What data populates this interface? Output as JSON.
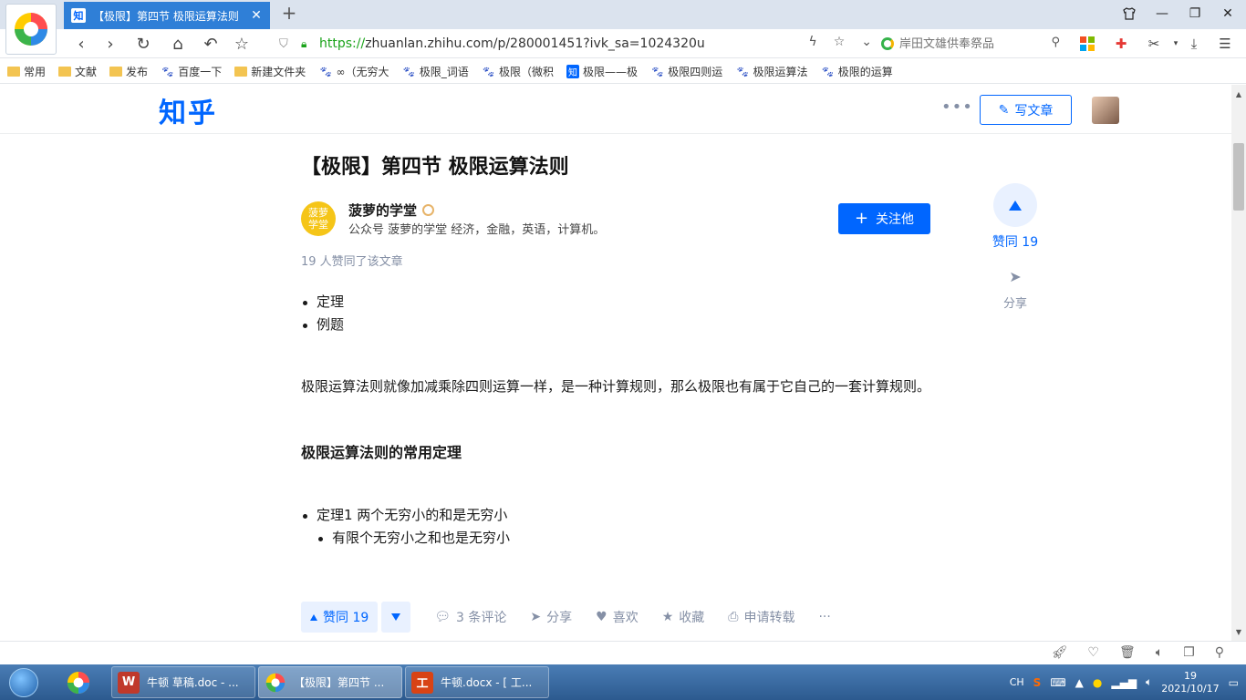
{
  "browser": {
    "tab_title": "【极限】第四节 极限运算法则",
    "tab_favicon": "知",
    "url_scheme": "https://",
    "url_rest": "zhuanlan.zhihu.com/p/280001451?ivk_sa=1024320u",
    "search_placeholder": "岸田文雄供奉祭品",
    "bookmarks": [
      {
        "icon": "folder",
        "label": "常用"
      },
      {
        "icon": "folder",
        "label": "文献"
      },
      {
        "icon": "folder",
        "label": "发布"
      },
      {
        "icon": "paw",
        "label": "百度一下"
      },
      {
        "icon": "folder",
        "label": "新建文件夹"
      },
      {
        "icon": "paw",
        "label": "∞（无穷大"
      },
      {
        "icon": "paw",
        "label": "极限_词语"
      },
      {
        "icon": "paw",
        "label": "极限（微积"
      },
      {
        "icon": "zhi",
        "label": "极限——极"
      },
      {
        "icon": "paw",
        "label": "极限四则运"
      },
      {
        "icon": "paw",
        "label": "极限运算法"
      },
      {
        "icon": "paw",
        "label": "极限的运算"
      }
    ]
  },
  "zhihu": {
    "logo": "知乎",
    "more": "•••",
    "write_label": "写文章"
  },
  "article": {
    "title": "【极限】第四节 极限运算法则",
    "author_avatar_text": "菠萝学堂",
    "author_name": "菠萝的学堂",
    "author_bio": "公众号 菠萝的学堂 经济，金融，英语，计算机。",
    "follow_label": "关注他",
    "upvoters": "19 人赞同了该文章",
    "toc": [
      "定理",
      "例题"
    ],
    "paragraph1": "极限运算法则就像加减乘除四则运算一样，是一种计算规则，那么极限也有属于它自己的一套计算规则。",
    "heading": "极限运算法则的常用定理",
    "theorem1": "定理1 两个无穷小的和是无穷小",
    "theorem1_sub": "有限个无穷小之和也是无穷小"
  },
  "side": {
    "vote_label": "赞同 19",
    "share_label": "分享"
  },
  "actions": {
    "vote_label": "赞同 19",
    "comments": "3 条评论",
    "share": "分享",
    "like": "喜欢",
    "favorite": "收藏",
    "repost": "申请转载",
    "more": "···"
  },
  "taskbar": {
    "tasks": [
      {
        "icon_text": "W",
        "label": "牛顿 草稿.doc - ..."
      },
      {
        "icon_text": "",
        "label": "【极限】第四节 ..."
      },
      {
        "icon_text": "工",
        "label": "牛顿.docx - [ 工..."
      }
    ],
    "ime": "CH",
    "time": "19",
    "date": "2021/10/17"
  },
  "colors": {
    "zhihu_blue": "#0066ff",
    "tab_active": "#2f7fd7",
    "taskbar": "#2c5a8f"
  }
}
